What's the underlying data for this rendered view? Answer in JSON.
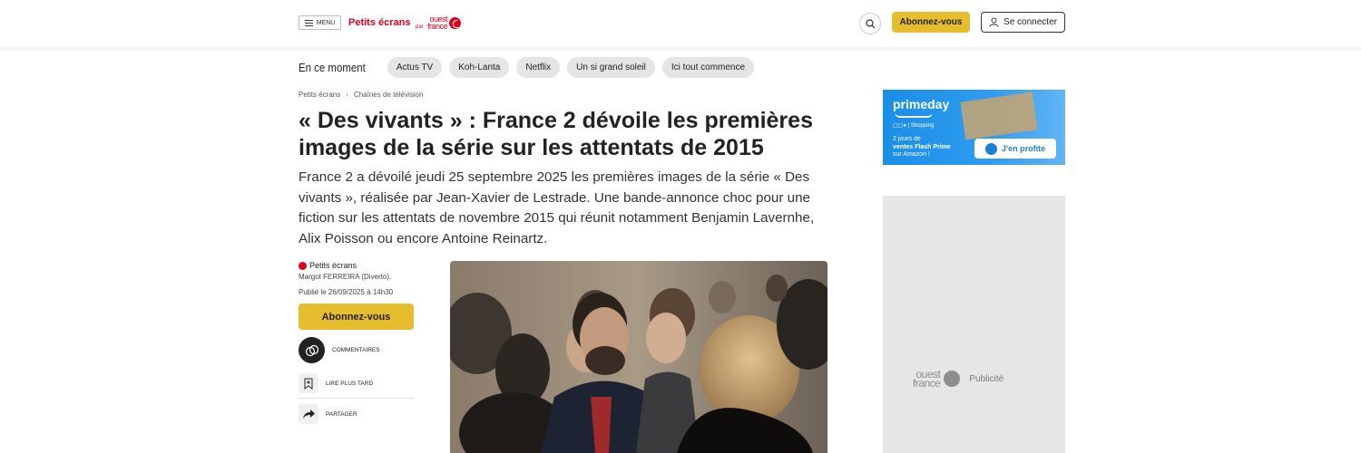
{
  "header": {
    "menu_label": "MENU",
    "site_title": "Petits écrans",
    "by_label": "par",
    "brand_logo": "ouest france",
    "subscribe_label": "Abonnez-vous",
    "login_label": "Se connecter"
  },
  "trending": {
    "label": "En ce moment",
    "chips": [
      "Actus TV",
      "Koh-Lanta",
      "Netflix",
      "Un si grand soleil",
      "Ici tout commence"
    ]
  },
  "breadcrumb": [
    "Petits écrans",
    "Chaînes de télévision"
  ],
  "article": {
    "title": "« Des vivants » : France 2 dévoile les premières images de la série sur les attentats de 2015",
    "lead": "France 2 a dévoilé jeudi 25 septembre 2025 les premières images de la série « Des vivants », réalisée par Jean-Xavier de Lestrade. Une bande-annonce choc pour une fiction sur les attentats de novembre 2015 qui réunit notamment Benjamin Lavernhe, Alix Poisson ou encore Antoine Reinartz.",
    "source": "Petits écrans",
    "author": "Margot FERREIRA (Diverto).",
    "date": "Publié le 26/09/2025 à 14h30",
    "subscribe_label": "Abonnez-vous",
    "comments_label": "COMMENTAIRES",
    "read_later_label": "LIRE PLUS TARD",
    "share_label": "PARTAGER"
  },
  "ad_prime": {
    "brand": "primeday",
    "sub_brand": "Shopping",
    "line1": "2 jours de",
    "line2": "ventes Flash Prime",
    "line3": "sur Amazon !",
    "cta": "J'en profite"
  },
  "ad_placeholder": {
    "logo": "ouest france",
    "label": "Publicité"
  },
  "icons": {
    "menu": "hamburger-icon",
    "search": "search-icon",
    "user": "user-icon",
    "comments": "comments-icon",
    "bookmark": "bookmark-icon",
    "share": "share-arrow-icon"
  },
  "colors": {
    "brand_red": "#e2001a",
    "subscribe_yellow": "#e6bd2c",
    "prime_blue": "#1a8ee6",
    "chip_gray": "#e5e5e5"
  }
}
